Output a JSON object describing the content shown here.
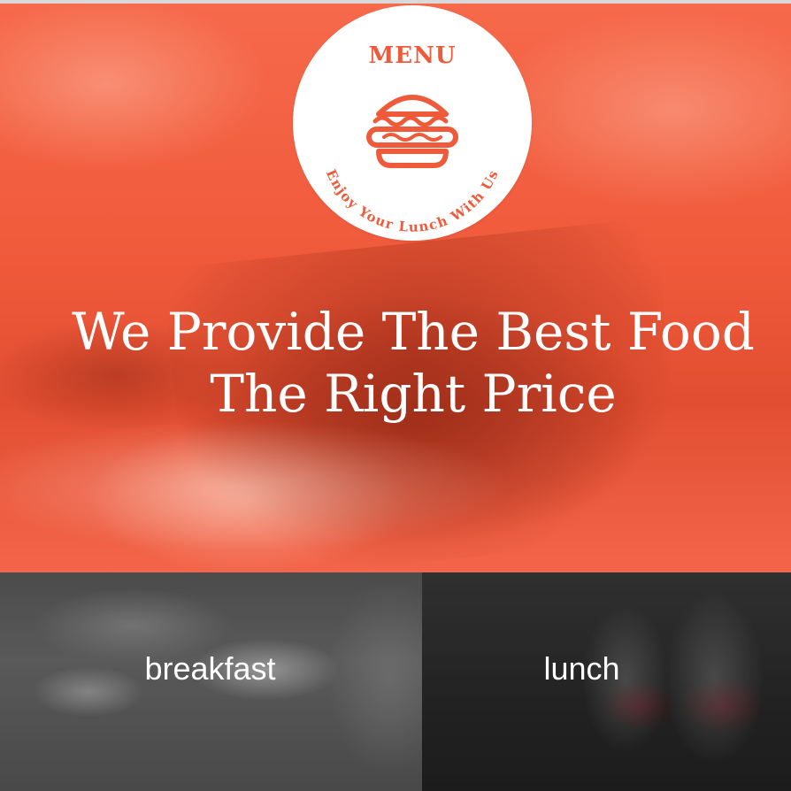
{
  "hero": {
    "logo": {
      "title": "MENU",
      "tagline": "Enjoy Your Lunch With Us",
      "icon": "burger-icon"
    },
    "headline_line1": "We Provide The Best Food",
    "headline_line2": "The Right Price"
  },
  "tiles": [
    {
      "label": "breakfast"
    },
    {
      "label": "lunch"
    }
  ],
  "colors": {
    "accent": "#ef5a3a",
    "hero_overlay": "#f45a3c",
    "text_on_image": "#ffffff"
  }
}
